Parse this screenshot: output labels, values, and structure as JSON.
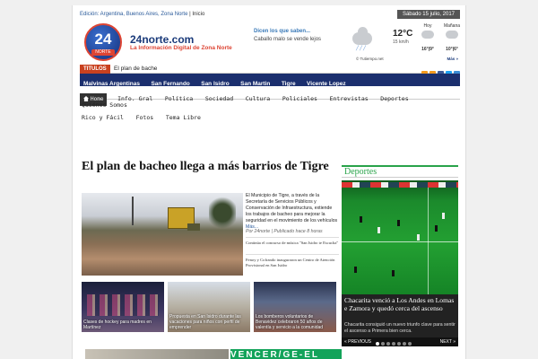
{
  "topbar": {
    "edition_label": "Edición: Argentina, Buenos Aires, Zona Norte",
    "separator": "|",
    "inicio": "Inicio",
    "date": "Sábado 15 julio, 2017"
  },
  "header": {
    "logo_number": "24",
    "logo_sub": "NORTE",
    "site_name": "24norte.com",
    "tagline": "La Información Digital de Zona Norte",
    "quote_title": "Dicen los que saben...",
    "quote_text": "Caballo malo se vende lejos"
  },
  "weather": {
    "temp": "12°C",
    "wind": "15 km/h",
    "provider": "© Tutiempo.net",
    "today_label": "Hoy",
    "today_temp": "16°|9°",
    "tomorrow_label": "Mañana",
    "tomorrow_temp": "10°|6°",
    "more": "Más »"
  },
  "titulos": {
    "tag": "TITULOS",
    "ticker": "El plan de bache"
  },
  "nav_primary": [
    "Malvinas Argentinas",
    "San Fernando",
    "San Isidro",
    "San Martin",
    "Tigre",
    "Vicente Lopez"
  ],
  "nav_secondary": {
    "home": "Home",
    "items": [
      "Info. Gral",
      "Política",
      "Sociedad",
      "Cultura",
      "Policiales",
      "Entrevistas",
      "Deportes",
      "Rico y Fácil",
      "Fotos",
      "Tema Libre"
    ],
    "extra": "Quiénes Somos"
  },
  "main": {
    "headline": "El plan de bacheo llega a más barrios de Tigre",
    "body": "El Municipio de Tigre, a través de la Secretaría de Servicios Públicos y Conservación de Infraestructura, extiende los trabajos de bacheo para mejorar la seguridad en el movimiento de los vehículos",
    "more": "Más...",
    "byline": "Por 24norte | Publicado hace 8 horas",
    "related": [
      "Continúa el concurso de música \"San Isidro te Escucha\"",
      "Fenoy y Cofrando inauguraron un Centro de Atención Provisional en San Isidro"
    ],
    "thumbs": [
      "Clases de hockey para madres en Martínez",
      "Propuesta en San Isidro durante las vacaciones para niños con perfil de emprender",
      "Los bomberos voluntarios de Benavidez celebraron 50 años de valentía y servicio a la comunidad"
    ],
    "banner_text": "VENCER/GE-EL"
  },
  "deportes": {
    "title": "Deportes",
    "headline": "Chacarita venció a Los Andes en Lomas e Zamora y quedó cerca del ascenso",
    "sub": "Chacarita consiguió un nuevo triunfo clave para sentir el ascenso a Primera bien cerca.",
    "prev": "« PREVIOUS",
    "next": "NEXT »"
  },
  "social_colors": [
    "#f39a1e",
    "#f39a1e",
    "#3b5998",
    "#1da1f2",
    "#3b8dd6"
  ]
}
